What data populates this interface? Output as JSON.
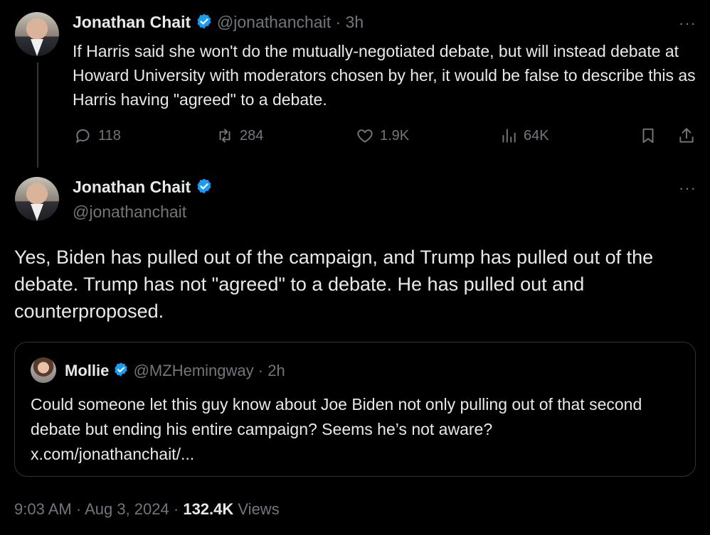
{
  "thread": {
    "name": "Jonathan Chait",
    "handle": "@jonathanchait",
    "separator": "·",
    "time": "3h",
    "text": "If Harris said she won't do the mutually-negotiated debate, but will instead debate at Howard University with moderators chosen by her, it would be false to describe this as Harris having \"agreed\" to a debate.",
    "replies": "118",
    "reposts": "284",
    "likes": "1.9K",
    "views": "64K"
  },
  "main": {
    "name": "Jonathan Chait",
    "handle": "@jonathanchait",
    "text": "Yes, Biden has pulled out of the campaign, and Trump has pulled out of the debate. Trump has not \"agreed\" to a debate. He has pulled out and counterproposed."
  },
  "quote": {
    "name": "Mollie",
    "handle": "@MZHemingway",
    "separator": "·",
    "time": "2h",
    "text": "Could someone let this guy know about Joe Biden not only pulling out of that second debate but ending his entire campaign? Seems he’s not aware?",
    "link": "x.com/jonathanchait/..."
  },
  "meta": {
    "time": "9:03 AM",
    "sep1": "·",
    "date": "Aug 3, 2024",
    "sep2": "·",
    "views_count": "132.4K",
    "views_label": "Views"
  },
  "colors": {
    "background": "#000000",
    "text": "#e7e9ea",
    "muted": "#71767b",
    "verified": "#1d9bf0",
    "border": "#2f3336"
  },
  "icons": [
    "more-icon",
    "verified-icon",
    "reply-icon",
    "repost-icon",
    "like-icon",
    "views-icon",
    "bookmark-icon",
    "share-icon"
  ]
}
